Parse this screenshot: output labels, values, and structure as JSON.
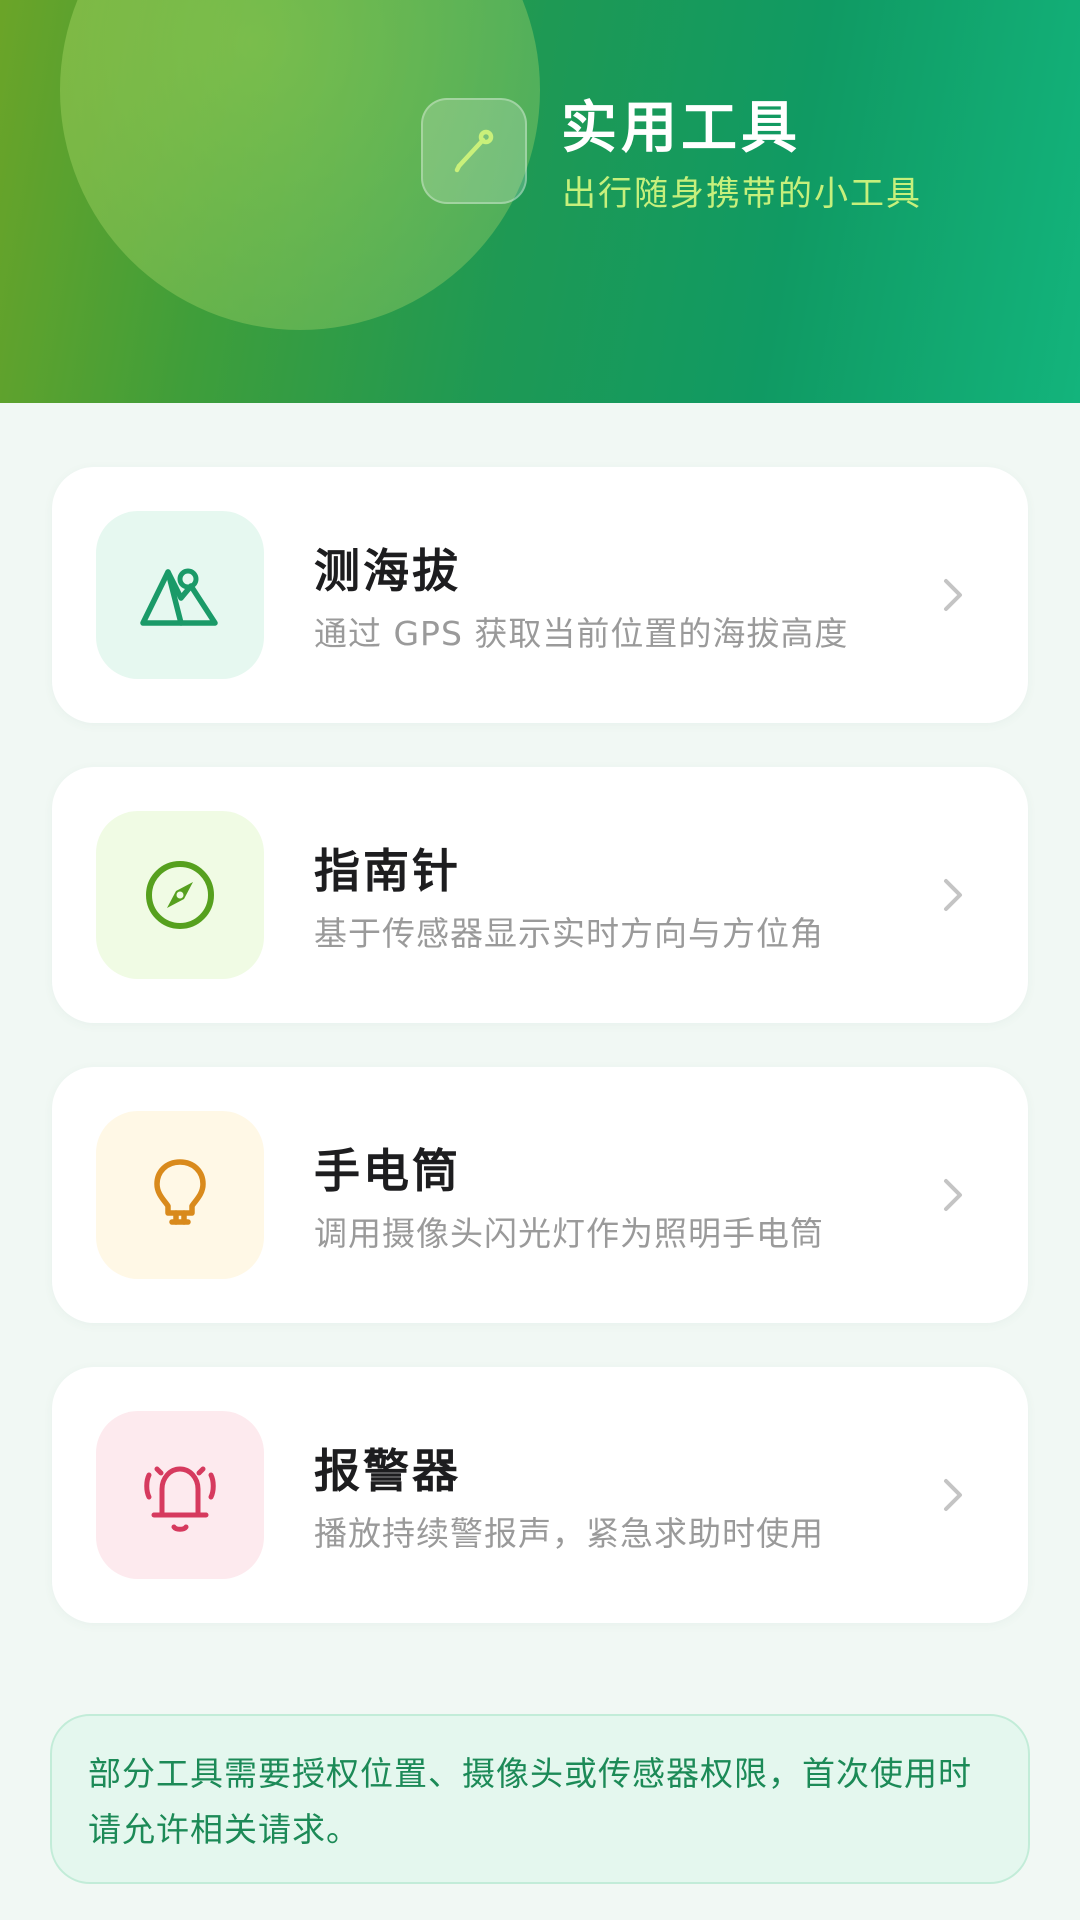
{
  "header": {
    "title": "实用工具",
    "subtitle": "出行随身携带的小工具",
    "icon": "pen-icon"
  },
  "tools": [
    {
      "title": "测海拔",
      "description": "通过 GPS 获取当前位置的海拔高度",
      "icon": "mountain-icon",
      "accent": "#1a9a68",
      "icon_bg": "#e6f8f0"
    },
    {
      "title": "指南针",
      "description": "基于传感器显示实时方向与方位角",
      "icon": "compass-icon",
      "accent": "#56a01e",
      "icon_bg": "#f0fbe4"
    },
    {
      "title": "手电筒",
      "description": "调用摄像头闪光灯作为照明手电筒",
      "icon": "lightbulb-icon",
      "accent": "#d98a1c",
      "icon_bg": "#fff8e6"
    },
    {
      "title": "报警器",
      "description": "播放持续警报声，紧急求助时使用",
      "icon": "bell-alarm-icon",
      "accent": "#d63a5e",
      "icon_bg": "#fdeaee"
    }
  ],
  "notice": {
    "text": "部分工具需要授权位置、摄像头或传感器权限，首次使用时请允许相关请求。"
  },
  "colors": {
    "brand_green": "#13a568",
    "subtitle_green": "#c6f07c",
    "notice_text": "#1c8a57",
    "notice_bg": "#e4f7ee",
    "page_bg": "#f1f8f4"
  }
}
